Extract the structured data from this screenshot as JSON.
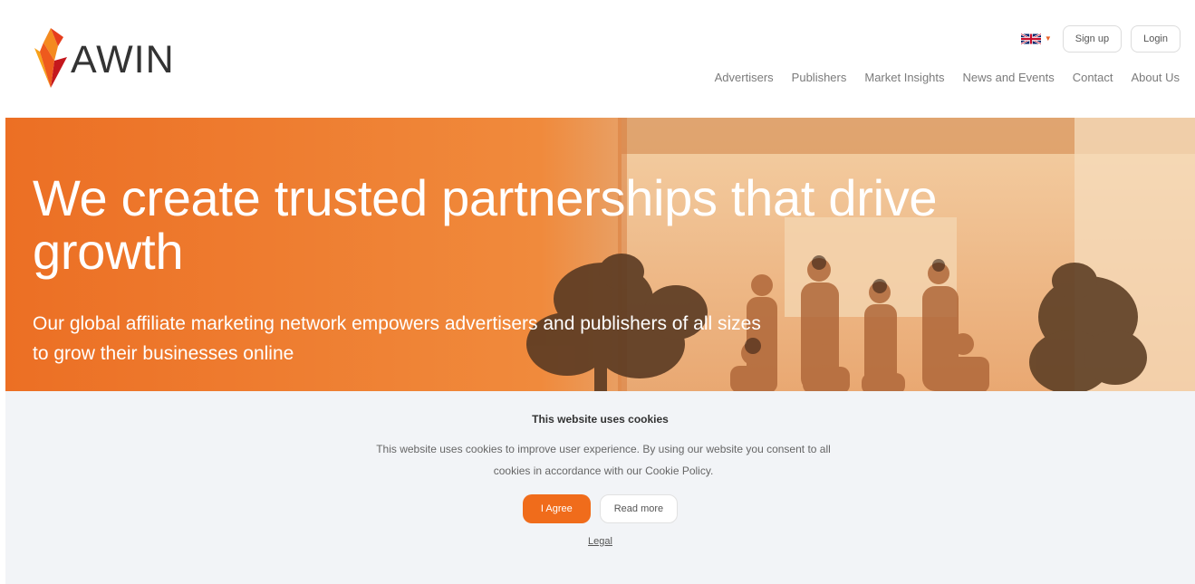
{
  "brand": {
    "name": "AWIN",
    "logo_icon": "awin-flame-logo-icon",
    "accent_color": "#f06c1b",
    "text_color": "#333333"
  },
  "header": {
    "language_icon": "uk-flag-icon",
    "sign_up_label": "Sign up",
    "login_label": "Login",
    "nav": [
      {
        "label": "Advertisers"
      },
      {
        "label": "Publishers"
      },
      {
        "label": "Market Insights"
      },
      {
        "label": "News and Events"
      },
      {
        "label": "Contact"
      },
      {
        "label": "About Us"
      }
    ]
  },
  "hero": {
    "title": "We create trusted partnerships that drive growth",
    "subtitle": "Our global affiliate marketing network empowers advertisers and publishers of all sizes to grow their businesses online"
  },
  "cookie_banner": {
    "title": "This website uses cookies",
    "body": "This website uses cookies to improve user experience. By using our website you consent to all cookies in accordance with our Cookie Policy.",
    "agree_label": "I Agree",
    "read_more_label": "Read more",
    "legal_label": "Legal",
    "background_color": "#f2f4f7"
  }
}
